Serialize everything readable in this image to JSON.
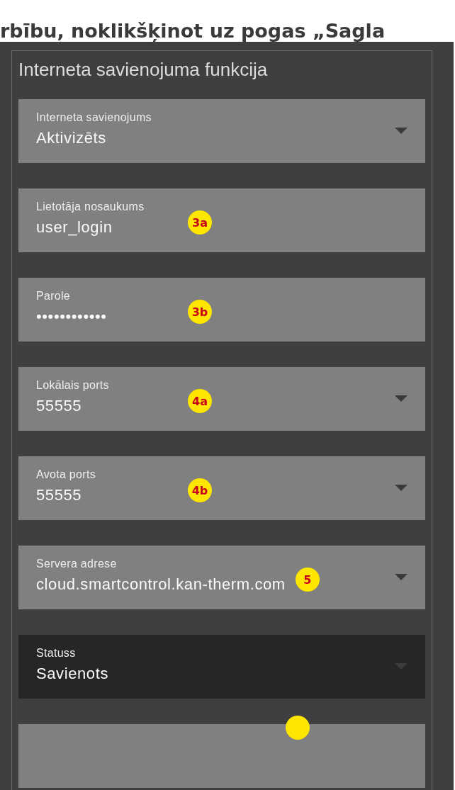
{
  "heading": "rbību, noklikšķinot uz pogas „Sagla",
  "panel": {
    "title": "Interneta savienojuma funkcija",
    "fields": [
      {
        "kind": "select",
        "label": "Interneta savienojums",
        "value": "Aktivizēts",
        "disabled": false
      },
      {
        "kind": "text",
        "label": "Lietotāja nosaukums",
        "value": "user_login",
        "disabled": false,
        "badge": "3a"
      },
      {
        "kind": "text",
        "label": "Parole",
        "value": "••••••••••••",
        "disabled": false,
        "badge": "3b"
      },
      {
        "kind": "select",
        "label": "Lokālais ports",
        "value": "55555",
        "disabled": false,
        "badge": "4a"
      },
      {
        "kind": "select",
        "label": "Avota ports",
        "value": "55555",
        "disabled": false,
        "badge": "4b"
      },
      {
        "kind": "select",
        "label": "Servera adrese",
        "value": "cloud.smartcontrol.kan-therm.com",
        "disabled": false,
        "badge": "5"
      },
      {
        "kind": "select",
        "label": "Statuss",
        "value": "Savienots",
        "disabled": true
      },
      {
        "kind": "blank",
        "disabled": false,
        "partial_badge": true
      }
    ]
  }
}
